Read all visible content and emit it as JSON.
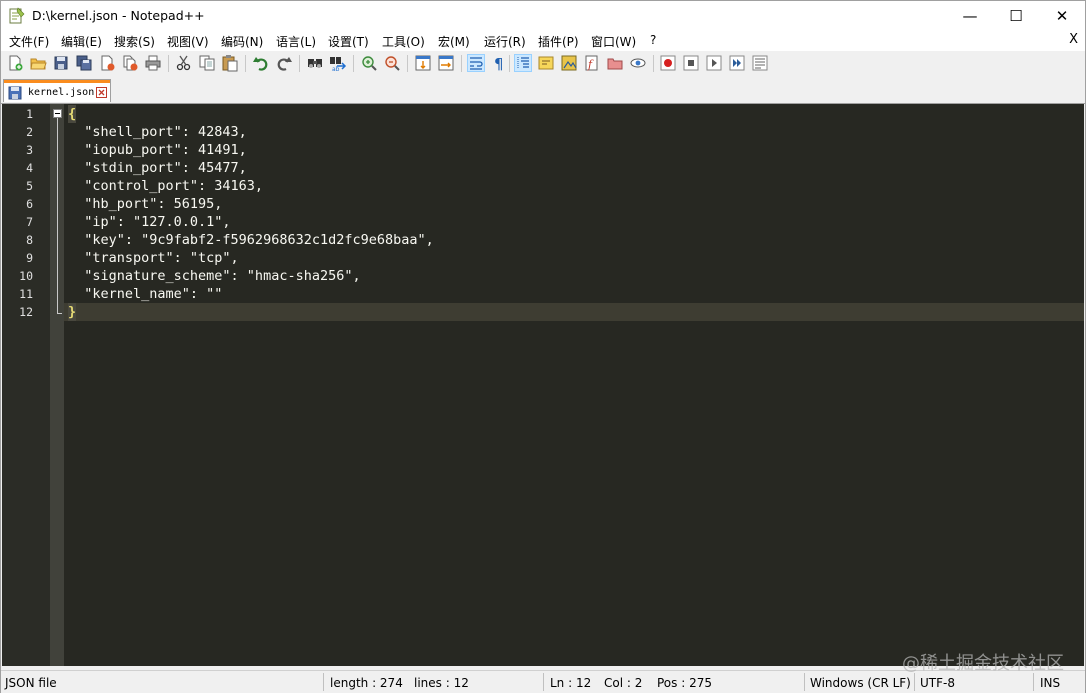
{
  "window": {
    "title": "D:\\kernel.json - Notepad++",
    "minimize": "—",
    "maximize": "☐",
    "close": "✕"
  },
  "menu": {
    "items": [
      "文件(F)",
      "编辑(E)",
      "搜索(S)",
      "视图(V)",
      "编码(N)",
      "语言(L)",
      "设置(T)",
      "工具(O)",
      "宏(M)",
      "运行(R)",
      "插件(P)",
      "窗口(W)",
      "?"
    ],
    "close_doc": "X"
  },
  "toolbar": {
    "icons": [
      "new-file-icon",
      "open-file-icon",
      "save-icon",
      "save-all-icon",
      "close-icon",
      "close-all-icon",
      "print-icon",
      "cut-icon",
      "copy-icon",
      "paste-icon",
      "undo-icon",
      "redo-icon",
      "find-icon",
      "replace-icon",
      "zoom-in-icon",
      "zoom-out-icon",
      "sync-vertical-icon",
      "sync-horizontal-icon",
      "word-wrap-icon",
      "show-all-chars-icon",
      "indent-guide-icon",
      "udl-icon",
      "doc-map-icon",
      "function-list-icon",
      "folder-workspace-icon",
      "monitor-icon",
      "record-macro-icon",
      "stop-record-icon",
      "play-macro-icon",
      "run-macro-multiple-icon",
      "save-macro-icon"
    ]
  },
  "tab": {
    "label": "kernel.json"
  },
  "editor": {
    "line_numbers": [
      "1",
      "2",
      "3",
      "4",
      "5",
      "6",
      "7",
      "8",
      "9",
      "10",
      "11",
      "12"
    ],
    "lines": [
      "{",
      "  \"shell_port\": 42843,",
      "  \"iopub_port\": 41491,",
      "  \"stdin_port\": 45477,",
      "  \"control_port\": 34163,",
      "  \"hb_port\": 56195,",
      "  \"ip\": \"127.0.0.1\",",
      "  \"key\": \"9c9fabf2-f5962968632c1d2fc9e68baa\",",
      "  \"transport\": \"tcp\",",
      "  \"signature_scheme\": \"hmac-sha256\",",
      "  \"kernel_name\": \"\"",
      "}"
    ],
    "colors": {
      "background": "#272822",
      "text": "#f8f8f2",
      "brace": "#e6db74",
      "current_line": "#3e3d32"
    }
  },
  "status": {
    "file_type": "JSON file",
    "length": "length : 274",
    "lines": "lines : 12",
    "ln": "Ln : 12",
    "col": "Col : 2",
    "pos": "Pos : 275",
    "eol": "Windows (CR LF)",
    "encoding": "UTF-8",
    "mode": "INS"
  },
  "watermark": "@稀土掘金技术社区"
}
